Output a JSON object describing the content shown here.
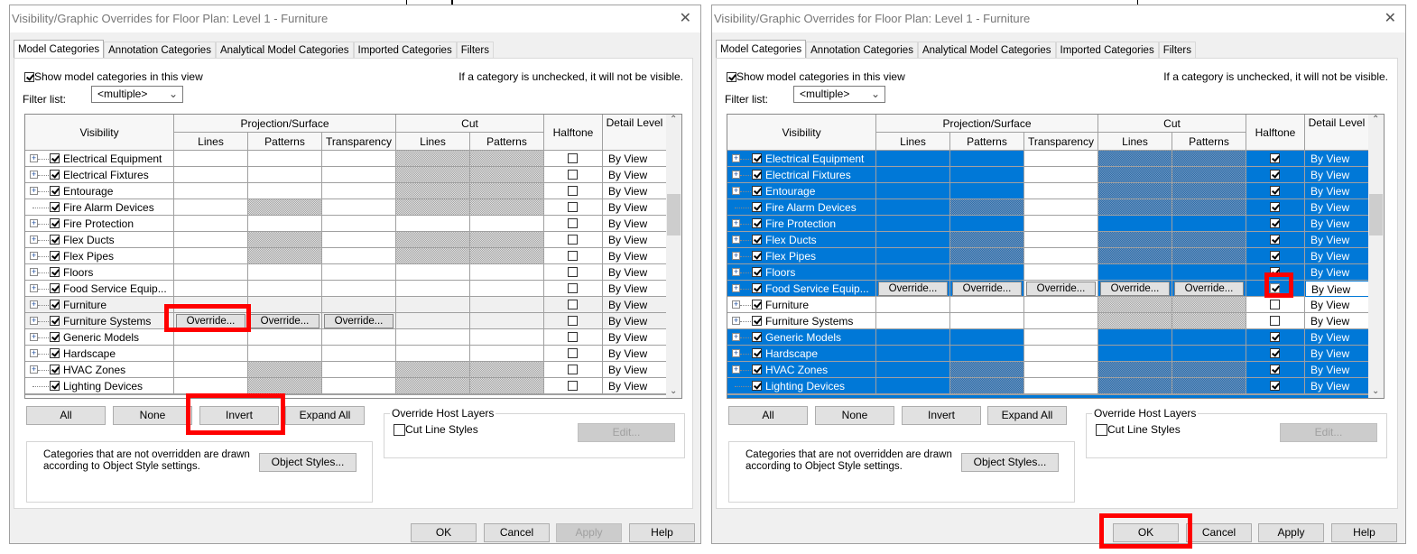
{
  "colors": {
    "selection": "#0078d7",
    "highlight": "#ff0000",
    "dialog_bg": "#f0f0f0"
  },
  "dialogs": [
    {
      "title": "Visibility/Graphic Overrides for Floor Plan: Level 1 - Furniture",
      "close_icon": "close-icon",
      "tabs": [
        "Model Categories",
        "Annotation Categories",
        "Analytical Model Categories",
        "Imported Categories",
        "Filters"
      ],
      "active_tab": 0,
      "show_categories_label": "Show model categories in this view",
      "show_categories_checked": true,
      "note": "If a category is unchecked, it will not be visible.",
      "filter_label": "Filter list:",
      "filter_value": "<multiple>",
      "headers": {
        "visibility": "Visibility",
        "projection": "Projection/Surface",
        "lines": "Lines",
        "patterns": "Patterns",
        "transparency": "Transparency",
        "cut": "Cut",
        "cut_lines": "Lines",
        "cut_patterns": "Patterns",
        "halftone": "Halftone",
        "detail": "Detail Level"
      },
      "override_label": "Override...",
      "rows": [
        {
          "name": "Electrical Equipment",
          "expand": true,
          "checked": true,
          "hatch_p": false,
          "hatch_c": true,
          "halftone": false,
          "detail": "By View"
        },
        {
          "name": "Electrical Fixtures",
          "expand": true,
          "checked": true,
          "hatch_p": false,
          "hatch_c": true,
          "halftone": false,
          "detail": "By View"
        },
        {
          "name": "Entourage",
          "expand": true,
          "checked": true,
          "hatch_p": false,
          "hatch_c": true,
          "halftone": false,
          "detail": "By View"
        },
        {
          "name": "Fire Alarm Devices",
          "expand": false,
          "checked": true,
          "hatch_p": true,
          "hatch_c": true,
          "halftone": false,
          "detail": "By View"
        },
        {
          "name": "Fire Protection",
          "expand": true,
          "checked": true,
          "hatch_p": false,
          "hatch_c": false,
          "halftone": false,
          "detail": "By View"
        },
        {
          "name": "Flex Ducts",
          "expand": true,
          "checked": true,
          "hatch_p": true,
          "hatch_c": true,
          "halftone": false,
          "detail": "By View"
        },
        {
          "name": "Flex Pipes",
          "expand": true,
          "checked": true,
          "hatch_p": true,
          "hatch_c": true,
          "halftone": false,
          "detail": "By View"
        },
        {
          "name": "Floors",
          "expand": true,
          "checked": true,
          "hatch_p": false,
          "hatch_c": false,
          "halftone": false,
          "detail": "By View"
        },
        {
          "name": "Food Service Equip...",
          "expand": true,
          "checked": true,
          "hatch_p": false,
          "hatch_c": false,
          "halftone": false,
          "detail": "By View"
        },
        {
          "name": "Furniture",
          "expand": true,
          "checked": true,
          "hatch_p": false,
          "hatch_c": true,
          "halftone": false,
          "detail": "By View",
          "gray": true
        },
        {
          "name": "Furniture Systems",
          "expand": true,
          "checked": true,
          "hatch_p": false,
          "hatch_c": true,
          "halftone": false,
          "detail": "By View",
          "gray": true,
          "overrides": [
            0,
            1,
            2
          ]
        },
        {
          "name": "Generic Models",
          "expand": true,
          "checked": true,
          "hatch_p": false,
          "hatch_c": false,
          "halftone": false,
          "detail": "By View"
        },
        {
          "name": "Hardscape",
          "expand": true,
          "checked": true,
          "hatch_p": false,
          "hatch_c": false,
          "halftone": false,
          "detail": "By View"
        },
        {
          "name": "HVAC Zones",
          "expand": true,
          "checked": true,
          "hatch_p": true,
          "hatch_c": true,
          "halftone": false,
          "detail": "By View"
        },
        {
          "name": "Lighting Devices",
          "expand": false,
          "checked": true,
          "hatch_p": true,
          "hatch_c": true,
          "halftone": false,
          "detail": "By View"
        }
      ],
      "buttons": {
        "all": "All",
        "none": "None",
        "invert": "Invert",
        "expand_all": "Expand All"
      },
      "host_layers": {
        "title": "Override Host Layers",
        "cut_line_styles": "Cut Line Styles",
        "edit": "Edit..."
      },
      "info": "Categories that are not overridden are drawn according to Object Style settings.",
      "object_styles": "Object Styles...",
      "footer": {
        "ok": "OK",
        "cancel": "Cancel",
        "apply": "Apply",
        "help": "Help"
      },
      "apply_enabled": false
    },
    {
      "title": "Visibility/Graphic Overrides for Floor Plan: Level 1 - Furniture",
      "close_icon": "close-icon",
      "tabs": [
        "Model Categories",
        "Annotation Categories",
        "Analytical Model Categories",
        "Imported Categories",
        "Filters"
      ],
      "active_tab": 0,
      "show_categories_label": "Show model categories in this view",
      "show_categories_checked": true,
      "note": "If a category is unchecked, it will not be visible.",
      "filter_label": "Filter list:",
      "filter_value": "<multiple>",
      "headers": {
        "visibility": "Visibility",
        "projection": "Projection/Surface",
        "lines": "Lines",
        "patterns": "Patterns",
        "transparency": "Transparency",
        "cut": "Cut",
        "cut_lines": "Lines",
        "cut_patterns": "Patterns",
        "halftone": "Halftone",
        "detail": "Detail Level"
      },
      "override_label": "Override...",
      "rows": [
        {
          "name": "Electrical Equipment",
          "expand": true,
          "checked": true,
          "hatch_p": false,
          "hatch_c": true,
          "halftone": true,
          "detail": "By View",
          "selected": true
        },
        {
          "name": "Electrical Fixtures",
          "expand": true,
          "checked": true,
          "hatch_p": false,
          "hatch_c": true,
          "halftone": true,
          "detail": "By View",
          "selected": true
        },
        {
          "name": "Entourage",
          "expand": true,
          "checked": true,
          "hatch_p": false,
          "hatch_c": true,
          "halftone": true,
          "detail": "By View",
          "selected": true
        },
        {
          "name": "Fire Alarm Devices",
          "expand": false,
          "checked": true,
          "hatch_p": true,
          "hatch_c": true,
          "halftone": true,
          "detail": "By View",
          "selected": true
        },
        {
          "name": "Fire Protection",
          "expand": true,
          "checked": true,
          "hatch_p": false,
          "hatch_c": false,
          "halftone": true,
          "detail": "By View",
          "selected": true
        },
        {
          "name": "Flex Ducts",
          "expand": true,
          "checked": true,
          "hatch_p": true,
          "hatch_c": true,
          "halftone": true,
          "detail": "By View",
          "selected": true
        },
        {
          "name": "Flex Pipes",
          "expand": true,
          "checked": true,
          "hatch_p": true,
          "hatch_c": true,
          "halftone": true,
          "detail": "By View",
          "selected": true
        },
        {
          "name": "Floors",
          "expand": true,
          "checked": true,
          "hatch_p": false,
          "hatch_c": false,
          "halftone": true,
          "detail": "By View",
          "selected": true
        },
        {
          "name": "Food Service Equip...",
          "expand": true,
          "checked": true,
          "hatch_p": false,
          "hatch_c": false,
          "halftone": true,
          "detail": "By View",
          "selected": true,
          "overrides": [
            0,
            1,
            2,
            3,
            4
          ],
          "active": true
        },
        {
          "name": "Furniture",
          "expand": true,
          "checked": true,
          "hatch_p": false,
          "hatch_c": true,
          "halftone": false,
          "detail": "By View"
        },
        {
          "name": "Furniture Systems",
          "expand": true,
          "checked": true,
          "hatch_p": false,
          "hatch_c": true,
          "halftone": false,
          "detail": "By View"
        },
        {
          "name": "Generic Models",
          "expand": true,
          "checked": true,
          "hatch_p": false,
          "hatch_c": false,
          "halftone": true,
          "detail": "By View",
          "selected": true
        },
        {
          "name": "Hardscape",
          "expand": true,
          "checked": true,
          "hatch_p": false,
          "hatch_c": false,
          "halftone": true,
          "detail": "By View",
          "selected": true
        },
        {
          "name": "HVAC Zones",
          "expand": true,
          "checked": true,
          "hatch_p": true,
          "hatch_c": true,
          "halftone": true,
          "detail": "By View",
          "selected": true
        },
        {
          "name": "Lighting Devices",
          "expand": false,
          "checked": true,
          "hatch_p": true,
          "hatch_c": true,
          "halftone": true,
          "detail": "By View",
          "selected": true
        }
      ],
      "buttons": {
        "all": "All",
        "none": "None",
        "invert": "Invert",
        "expand_all": "Expand All"
      },
      "host_layers": {
        "title": "Override Host Layers",
        "cut_line_styles": "Cut Line Styles",
        "edit": "Edit..."
      },
      "info": "Categories that are not overridden are drawn according to Object Style settings.",
      "object_styles": "Object Styles...",
      "footer": {
        "ok": "OK",
        "cancel": "Cancel",
        "apply": "Apply",
        "help": "Help"
      },
      "apply_enabled": true
    }
  ]
}
